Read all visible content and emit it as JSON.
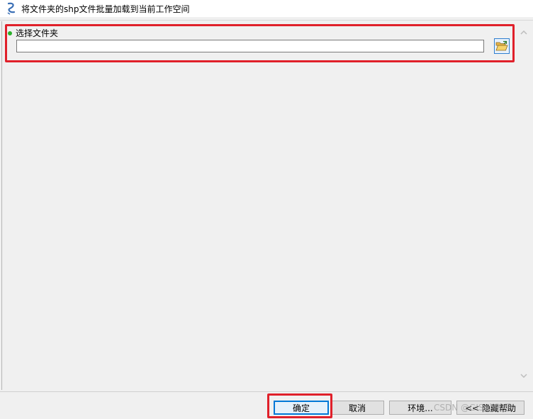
{
  "window": {
    "title": "将文件夹的shp文件批量加载到当前工作空间",
    "icon": "arctoolbox-script-icon"
  },
  "params": {
    "folder": {
      "label": "选择文件夹",
      "value": "",
      "required_color": "#2bb02b",
      "browse_icon": "open-folder-icon"
    }
  },
  "buttons": {
    "ok": "确定",
    "cancel": "取消",
    "environments": "环境...",
    "hide_help": "<< 隐藏帮助"
  },
  "watermark": "CSDN @GIS 小助手",
  "colors": {
    "annotation_red": "#e0202a",
    "focus_blue": "#0078d7"
  }
}
